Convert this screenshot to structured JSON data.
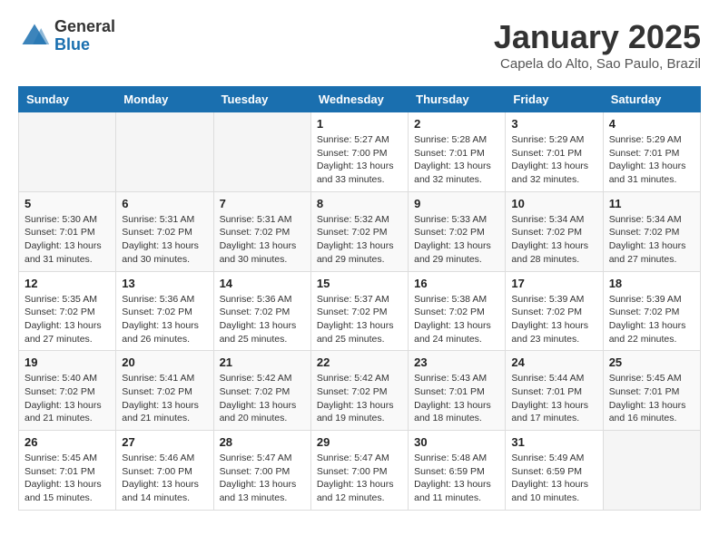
{
  "header": {
    "logo_general": "General",
    "logo_blue": "Blue",
    "title": "January 2025",
    "location": "Capela do Alto, Sao Paulo, Brazil"
  },
  "calendar": {
    "weekdays": [
      "Sunday",
      "Monday",
      "Tuesday",
      "Wednesday",
      "Thursday",
      "Friday",
      "Saturday"
    ],
    "weeks": [
      [
        {
          "day": "",
          "info": ""
        },
        {
          "day": "",
          "info": ""
        },
        {
          "day": "",
          "info": ""
        },
        {
          "day": "1",
          "info": "Sunrise: 5:27 AM\nSunset: 7:00 PM\nDaylight: 13 hours and 33 minutes."
        },
        {
          "day": "2",
          "info": "Sunrise: 5:28 AM\nSunset: 7:01 PM\nDaylight: 13 hours and 32 minutes."
        },
        {
          "day": "3",
          "info": "Sunrise: 5:29 AM\nSunset: 7:01 PM\nDaylight: 13 hours and 32 minutes."
        },
        {
          "day": "4",
          "info": "Sunrise: 5:29 AM\nSunset: 7:01 PM\nDaylight: 13 hours and 31 minutes."
        }
      ],
      [
        {
          "day": "5",
          "info": "Sunrise: 5:30 AM\nSunset: 7:01 PM\nDaylight: 13 hours and 31 minutes."
        },
        {
          "day": "6",
          "info": "Sunrise: 5:31 AM\nSunset: 7:02 PM\nDaylight: 13 hours and 30 minutes."
        },
        {
          "day": "7",
          "info": "Sunrise: 5:31 AM\nSunset: 7:02 PM\nDaylight: 13 hours and 30 minutes."
        },
        {
          "day": "8",
          "info": "Sunrise: 5:32 AM\nSunset: 7:02 PM\nDaylight: 13 hours and 29 minutes."
        },
        {
          "day": "9",
          "info": "Sunrise: 5:33 AM\nSunset: 7:02 PM\nDaylight: 13 hours and 29 minutes."
        },
        {
          "day": "10",
          "info": "Sunrise: 5:34 AM\nSunset: 7:02 PM\nDaylight: 13 hours and 28 minutes."
        },
        {
          "day": "11",
          "info": "Sunrise: 5:34 AM\nSunset: 7:02 PM\nDaylight: 13 hours and 27 minutes."
        }
      ],
      [
        {
          "day": "12",
          "info": "Sunrise: 5:35 AM\nSunset: 7:02 PM\nDaylight: 13 hours and 27 minutes."
        },
        {
          "day": "13",
          "info": "Sunrise: 5:36 AM\nSunset: 7:02 PM\nDaylight: 13 hours and 26 minutes."
        },
        {
          "day": "14",
          "info": "Sunrise: 5:36 AM\nSunset: 7:02 PM\nDaylight: 13 hours and 25 minutes."
        },
        {
          "day": "15",
          "info": "Sunrise: 5:37 AM\nSunset: 7:02 PM\nDaylight: 13 hours and 25 minutes."
        },
        {
          "day": "16",
          "info": "Sunrise: 5:38 AM\nSunset: 7:02 PM\nDaylight: 13 hours and 24 minutes."
        },
        {
          "day": "17",
          "info": "Sunrise: 5:39 AM\nSunset: 7:02 PM\nDaylight: 13 hours and 23 minutes."
        },
        {
          "day": "18",
          "info": "Sunrise: 5:39 AM\nSunset: 7:02 PM\nDaylight: 13 hours and 22 minutes."
        }
      ],
      [
        {
          "day": "19",
          "info": "Sunrise: 5:40 AM\nSunset: 7:02 PM\nDaylight: 13 hours and 21 minutes."
        },
        {
          "day": "20",
          "info": "Sunrise: 5:41 AM\nSunset: 7:02 PM\nDaylight: 13 hours and 21 minutes."
        },
        {
          "day": "21",
          "info": "Sunrise: 5:42 AM\nSunset: 7:02 PM\nDaylight: 13 hours and 20 minutes."
        },
        {
          "day": "22",
          "info": "Sunrise: 5:42 AM\nSunset: 7:02 PM\nDaylight: 13 hours and 19 minutes."
        },
        {
          "day": "23",
          "info": "Sunrise: 5:43 AM\nSunset: 7:01 PM\nDaylight: 13 hours and 18 minutes."
        },
        {
          "day": "24",
          "info": "Sunrise: 5:44 AM\nSunset: 7:01 PM\nDaylight: 13 hours and 17 minutes."
        },
        {
          "day": "25",
          "info": "Sunrise: 5:45 AM\nSunset: 7:01 PM\nDaylight: 13 hours and 16 minutes."
        }
      ],
      [
        {
          "day": "26",
          "info": "Sunrise: 5:45 AM\nSunset: 7:01 PM\nDaylight: 13 hours and 15 minutes."
        },
        {
          "day": "27",
          "info": "Sunrise: 5:46 AM\nSunset: 7:00 PM\nDaylight: 13 hours and 14 minutes."
        },
        {
          "day": "28",
          "info": "Sunrise: 5:47 AM\nSunset: 7:00 PM\nDaylight: 13 hours and 13 minutes."
        },
        {
          "day": "29",
          "info": "Sunrise: 5:47 AM\nSunset: 7:00 PM\nDaylight: 13 hours and 12 minutes."
        },
        {
          "day": "30",
          "info": "Sunrise: 5:48 AM\nSunset: 6:59 PM\nDaylight: 13 hours and 11 minutes."
        },
        {
          "day": "31",
          "info": "Sunrise: 5:49 AM\nSunset: 6:59 PM\nDaylight: 13 hours and 10 minutes."
        },
        {
          "day": "",
          "info": ""
        }
      ]
    ]
  }
}
